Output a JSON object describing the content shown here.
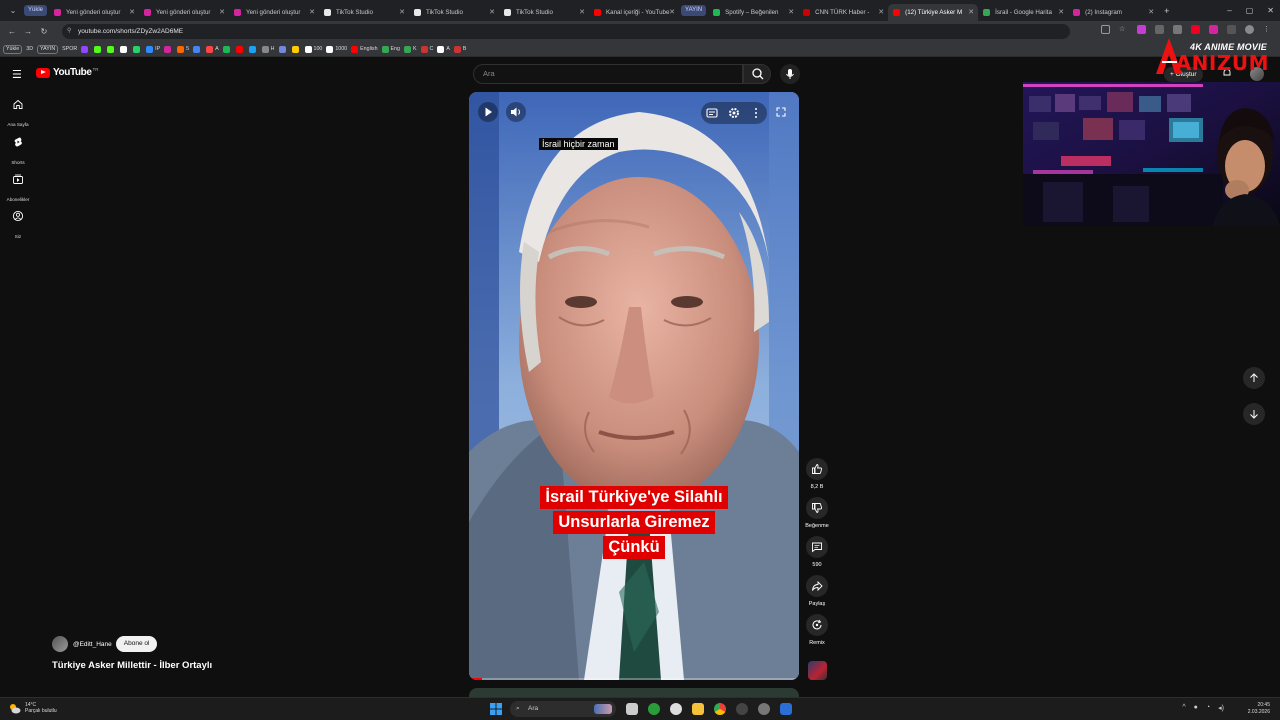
{
  "browser": {
    "tab_group_pill": "Yükle",
    "tabs": [
      {
        "label": "Yeni gönderi oluştur",
        "color": "#d6249f"
      },
      {
        "label": "Yeni gönderi oluştur",
        "color": "#d6249f"
      },
      {
        "label": "Yeni gönderi oluştur",
        "color": "#d6249f"
      },
      {
        "label": "TikTok Studio",
        "color": "#e8e8e8"
      },
      {
        "label": "TikTok Studio",
        "color": "#e8e8e8"
      },
      {
        "label": "TikTok Studio",
        "color": "#e8e8e8"
      },
      {
        "label": "Kanal içeriği - YouTube",
        "color": "#ff0000"
      },
      {
        "label": "Spotify – Beğenilen",
        "color": "#1db954"
      },
      {
        "label": "CNN TÜRK Haber -",
        "color": "#cc0000"
      },
      {
        "label": "(12) Türkiye Asker M",
        "color": "#ff0000"
      },
      {
        "label": "İsrail - Google Harita",
        "color": "#34a853"
      },
      {
        "label": "(2) Instagram",
        "color": "#d6249f"
      }
    ],
    "tab_group_pill_2": "YAYIN",
    "url": "youtube.com/shorts/ZDyZw2AD6ME",
    "bookmarks": [
      {
        "label": "Yükle",
        "boxed": true,
        "color": ""
      },
      {
        "label": "3D",
        "boxed": false,
        "color": ""
      },
      {
        "label": "YAYIN",
        "boxed": true,
        "color": ""
      },
      {
        "label": "SPOR",
        "boxed": false,
        "color": ""
      },
      {
        "label": "",
        "boxed": false,
        "color": "#9146ff"
      },
      {
        "label": "",
        "boxed": false,
        "color": "#53fc18"
      },
      {
        "label": "",
        "boxed": false,
        "color": "#53fc18"
      },
      {
        "label": "",
        "boxed": false,
        "color": "#ffffff"
      },
      {
        "label": "",
        "boxed": false,
        "color": "#25d366"
      },
      {
        "label": "IP",
        "boxed": false,
        "color": "#2d8cff"
      },
      {
        "label": "",
        "boxed": false,
        "color": "#d6249f"
      },
      {
        "label": "5",
        "boxed": false,
        "color": "#ff6600"
      },
      {
        "label": "",
        "boxed": false,
        "color": "#4285f4"
      },
      {
        "label": "A",
        "boxed": false,
        "color": "#ff4444"
      },
      {
        "label": "",
        "boxed": false,
        "color": "#1db954"
      },
      {
        "label": "",
        "boxed": false,
        "color": "#ff0000"
      },
      {
        "label": "",
        "boxed": false,
        "color": "#1da1f2"
      },
      {
        "label": "H",
        "boxed": false,
        "color": "#888888"
      },
      {
        "label": "",
        "boxed": false,
        "color": "#7289da"
      },
      {
        "label": "",
        "boxed": false,
        "color": "#ffcc00"
      },
      {
        "label": "100",
        "boxed": false,
        "color": "#ffffff"
      },
      {
        "label": "1000",
        "boxed": false,
        "color": "#ffffff"
      },
      {
        "label": "English",
        "boxed": false,
        "color": "#ff0000"
      },
      {
        "label": "Eng",
        "boxed": false,
        "color": "#34a853"
      },
      {
        "label": "K",
        "boxed": false,
        "color": "#34a853"
      },
      {
        "label": "C",
        "boxed": false,
        "color": "#cc3333"
      },
      {
        "label": "A",
        "boxed": false,
        "color": "#ffffff"
      },
      {
        "label": "B",
        "boxed": false,
        "color": "#cc3333"
      }
    ]
  },
  "youtube": {
    "logo_text": "YouTube",
    "country": "TR",
    "search_placeholder": "Ara",
    "create_label": "Oluştur",
    "sidebar": [
      {
        "label": "Ana Sayfa",
        "icon": "home-icon"
      },
      {
        "label": "Shorts",
        "icon": "shorts-icon"
      },
      {
        "label": "Abonelikler",
        "icon": "subscriptions-icon"
      },
      {
        "label": "Siz",
        "icon": "you-icon"
      }
    ],
    "video": {
      "caption_top": "İsrail hiçbir zaman",
      "caption_red": [
        "İsrail Türkiye'ye Silahlı",
        "Unsurlarla Giremez",
        "Çünkü"
      ],
      "progress": 0.04
    },
    "actions": {
      "like_count": "8,2 B",
      "dislike_label": "Beğenme",
      "comment_count": "590",
      "share_label": "Paylaş",
      "remix_label": "Remix"
    },
    "channel_name": "@Editt_Hane",
    "subscribe_label": "Abone ol",
    "video_title": "Türkiye Asker Millettir - İlber Ortaylı"
  },
  "watermark": {
    "top": "4K ANIME MOVIE",
    "bottom": "ANIZUM"
  },
  "taskbar": {
    "temperature": "14°C",
    "weather": "Parçalı bulutlu",
    "search": "Ara",
    "time": "20:45",
    "date": "2.03.2026"
  }
}
